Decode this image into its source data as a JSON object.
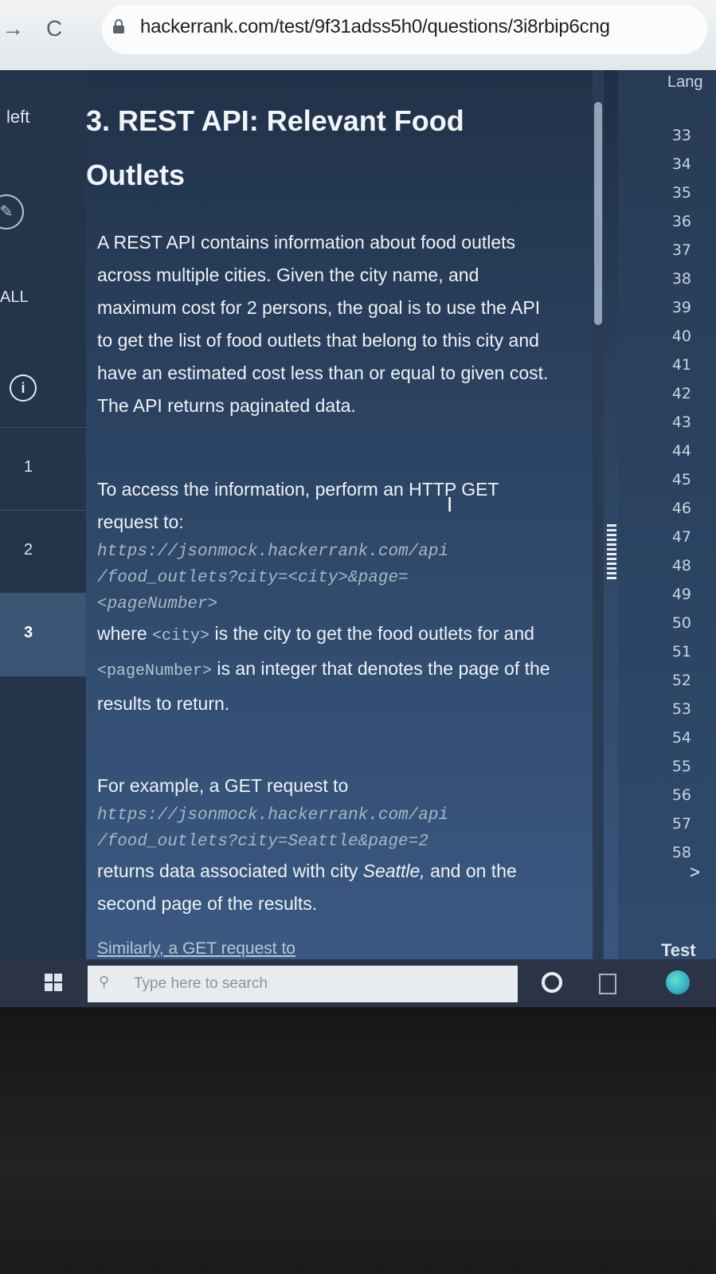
{
  "browser": {
    "url": "hackerrank.com/test/9f31adss5h0/questions/3i8rbip6cng",
    "back_glyph": "→",
    "reload_glyph": "C"
  },
  "sidebar": {
    "left_label": "left",
    "all_label": "ALL",
    "questions": [
      "1",
      "2",
      "3"
    ],
    "active_question": "3"
  },
  "question": {
    "title": "3. REST API: Relevant Food Outlets",
    "para1": "A REST API contains information about food outlets across multiple cities. Given the city name, and maximum cost for 2 persons, the goal is to use the API to get the list of food outlets that belong to this city and have an estimated cost less than or equal to given cost. The API returns paginated data.",
    "para2_intro": "To access the information, perform an HTTP GET request to:",
    "endpoint_lines": [
      "https://jsonmock.hackerrank.com/api",
      "/food_outlets?city=<city>&page=",
      "<pageNumber>"
    ],
    "where_text": "where",
    "city_code": "<city>",
    "where_mid": "is the city to get the food outlets for and",
    "page_code": "<pageNumber>",
    "where_end": "is an integer that denotes the page of the results to return.",
    "example_intro": "For example, a GET request to",
    "example_lines": [
      "https://jsonmock.hackerrank.com/api",
      "/food_outlets?city=Seattle&page=2"
    ],
    "example_after": "returns data associated with city",
    "example_city": "Seattle,",
    "example_end": "and on the second page of the results.",
    "similarly": "Similarly, a GET request to"
  },
  "editor": {
    "language_label": "Lang",
    "line_numbers": [
      "33",
      "34",
      "35",
      "36",
      "37",
      "38",
      "39",
      "40",
      "41",
      "42",
      "43",
      "44",
      "45",
      "46",
      "47",
      "48",
      "49",
      "50",
      "51",
      "52",
      "53",
      "54",
      "55",
      "56",
      "57",
      "58"
    ],
    "expand_glyph": ">",
    "test_label": "Test"
  },
  "taskbar": {
    "search_placeholder": "Type here to search"
  }
}
